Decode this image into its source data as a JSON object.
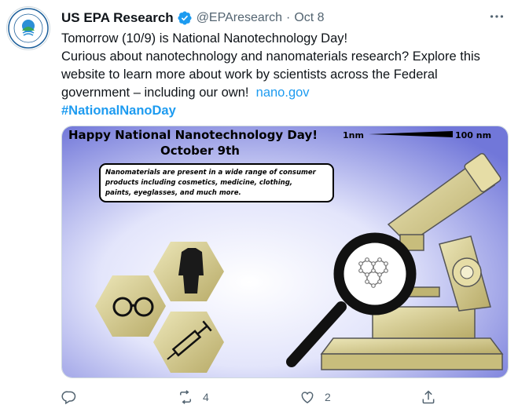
{
  "tweet": {
    "author_name": "US EPA Research",
    "handle": "@EPAresearch",
    "separator": "·",
    "date": "Oct 8",
    "more_icon": "more-horizontal-icon",
    "verified_icon": "verified-badge-icon",
    "text_line1": "Tomorrow (10/9) is National Nanotechnology Day!",
    "text_body": "Curious about nanotechnology and nanomaterials research? Explore this website to learn more about work by scientists across the Federal government – including our own!",
    "link_text": "nano.gov",
    "hashtag": "#NationalNanoDay",
    "accent_color": "#1d9bf0"
  },
  "media": {
    "headline": "Happy  National Nanotechnology Day!",
    "date_text": "October 9th",
    "scale_left": "1nm",
    "scale_right": "100 nm",
    "callout": [
      "Nanomaterials are present in a wide range of consumer",
      "products including cosmetics, medicine, clothing,",
      "paints, eyeglasses, and much more."
    ]
  },
  "actions": {
    "reply_count": "",
    "retweet_count": "4",
    "like_count": "2",
    "share_count": ""
  }
}
